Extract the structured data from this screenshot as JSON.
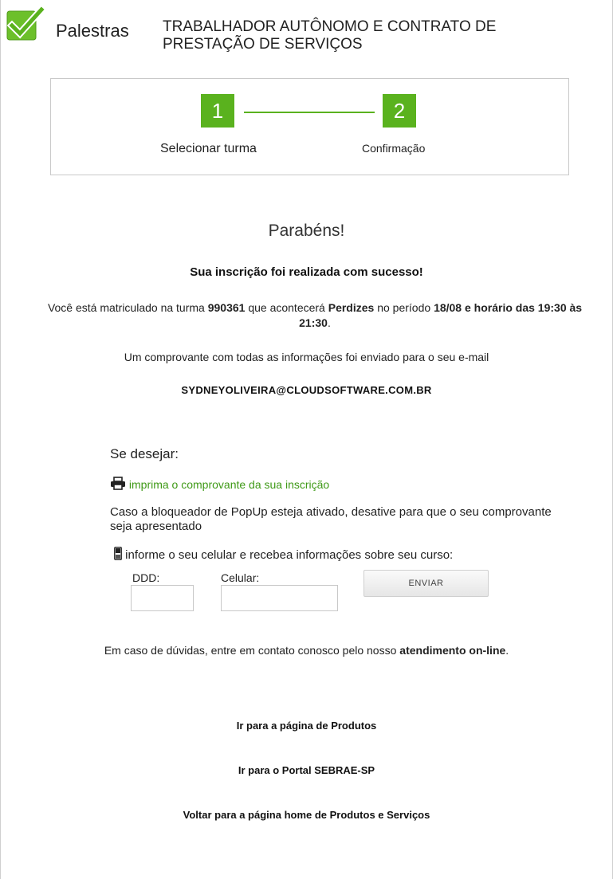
{
  "header": {
    "brand": "Palestras",
    "title": "TRABALHADOR AUTÔNOMO E CONTRATO DE PRESTAÇÃO DE SERVIÇOS"
  },
  "steps": [
    {
      "number": "1",
      "label": "Selecionar turma"
    },
    {
      "number": "2",
      "label": "Confirmação"
    }
  ],
  "confirmation": {
    "heading": "Parabéns!",
    "success": "Sua inscrição foi realizada com sucesso!",
    "enroll_prefix": "Você está matriculado na turma ",
    "class_code": "990361",
    "enroll_mid1": " que acontecerá ",
    "location": "Perdizes",
    "enroll_mid2": " no período ",
    "schedule": "18/08 e horário das 19:30 às 21:30",
    "enroll_end": ".",
    "receipt_msg": "Um comprovante com todas as informações foi enviado para o seu e-mail",
    "email": "SYDNEYOLIVEIRA@CLOUDSOFTWARE.COM.BR"
  },
  "options": {
    "title": "Se desejar:",
    "print_link": "imprima o comprovante da sua inscrição",
    "popup_msg": "Caso a bloqueador de PopUp esteja ativado, desative para que o seu comprovante seja apresentado",
    "phone_msg": "informe o seu celular e recebea informações sobre seu curso:",
    "ddd_label": "DDD:",
    "ddd_value": "",
    "cel_label": "Celular:",
    "cel_value": "",
    "send_button": "ENVIAR"
  },
  "help": {
    "prefix": "Em caso de dúvidas, entre em contato conosco pelo nosso ",
    "link": "atendimento on-line",
    "suffix": "."
  },
  "links": [
    "Ir para a página de Produtos",
    "Ir para o Portal SEBRAE-SP",
    "Voltar para a página home de Produtos e Serviços"
  ],
  "colors": {
    "accent": "#5ab21e",
    "link_green": "#3f9a17"
  },
  "icons": {
    "logo": "checkmark-icon",
    "print": "printer-icon",
    "phone": "mobile-phone-icon"
  }
}
